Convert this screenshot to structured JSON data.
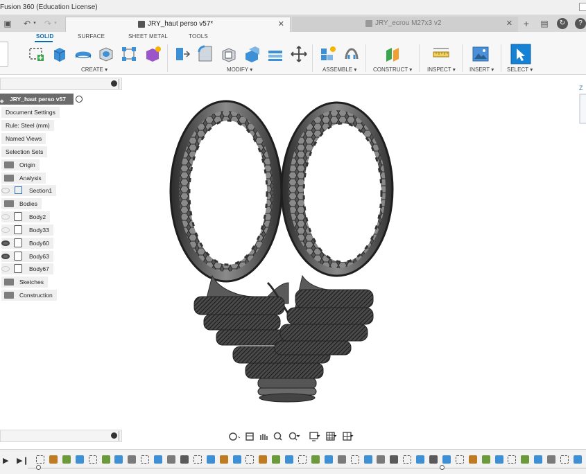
{
  "app": {
    "window_title": "Fusion 360 (Education License)"
  },
  "tabs": [
    {
      "label": "JRY_haut perso v57*",
      "active": true
    },
    {
      "label": "JRY_ecrou M27x3 v2",
      "active": false
    }
  ],
  "workspace_tabs": [
    "SOLID",
    "SURFACE",
    "SHEET METAL",
    "TOOLS"
  ],
  "tool_groups": [
    "CREATE",
    "MODIFY",
    "ASSEMBLE",
    "CONSTRUCT",
    "INSPECT",
    "INSERT",
    "SELECT"
  ],
  "browser": {
    "root": "JRY_haut perso v57",
    "items": [
      {
        "label": "Document Settings",
        "type": "settings"
      },
      {
        "label": "Rule: Steel (mm)",
        "type": "settings"
      },
      {
        "label": "Named Views",
        "type": "folder"
      },
      {
        "label": "Selection Sets",
        "type": "folder"
      },
      {
        "label": "Origin",
        "type": "folder"
      },
      {
        "label": "Analysis",
        "type": "folder"
      },
      {
        "label": "Section1",
        "type": "analysis"
      },
      {
        "label": "Bodies",
        "type": "folder"
      },
      {
        "label": "Body2",
        "type": "body",
        "visible": false
      },
      {
        "label": "Body33",
        "type": "body",
        "visible": false
      },
      {
        "label": "Body60",
        "type": "body",
        "visible": true
      },
      {
        "label": "Body63",
        "type": "body",
        "visible": true
      },
      {
        "label": "Body67",
        "type": "body",
        "visible": false
      },
      {
        "label": "Sketches",
        "type": "folder"
      },
      {
        "label": "Construction",
        "type": "folder"
      }
    ]
  },
  "colors": {
    "accent": "#0a6ab0",
    "model_dark": "#3a3a3a",
    "model_mid": "#6e6e6e",
    "model_light": "#9a9a9a"
  },
  "viewcube": {
    "axis_label": "Z"
  }
}
